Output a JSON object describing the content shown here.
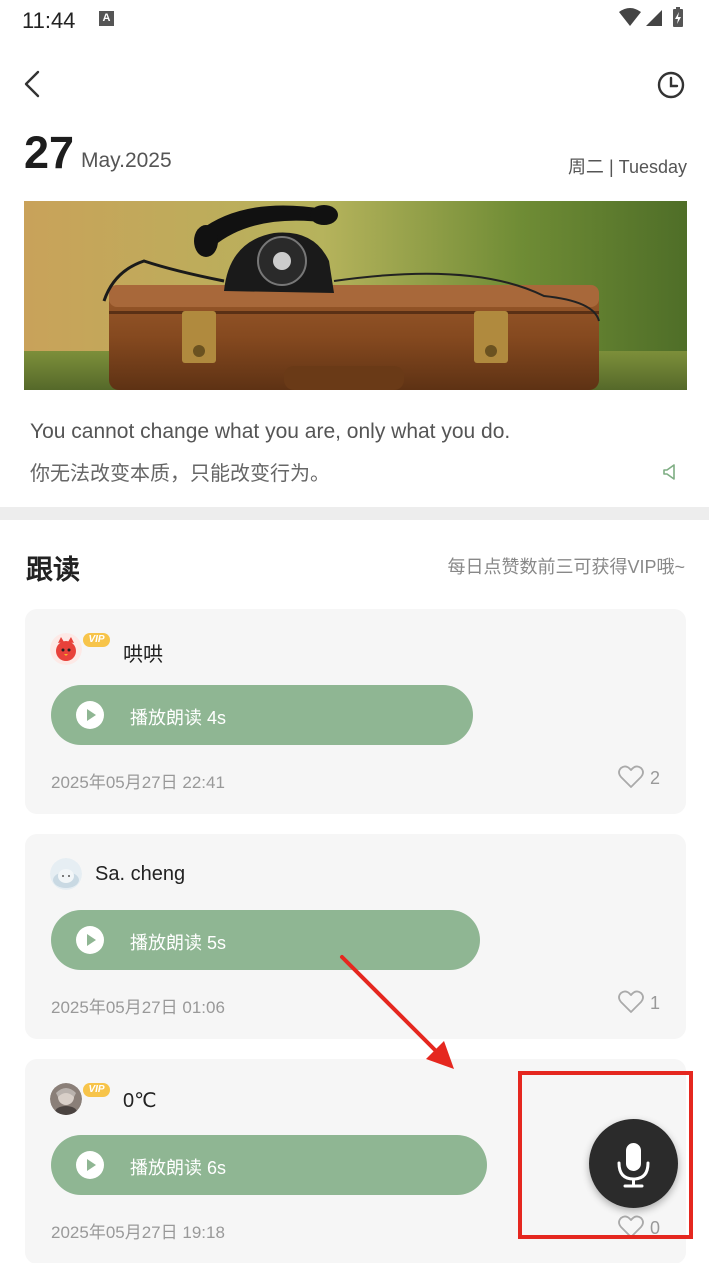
{
  "status_bar": {
    "time": "11:44",
    "notification_letter": "A"
  },
  "header": {
    "back_icon": "chevron-left-icon",
    "history_icon": "clock-icon"
  },
  "date": {
    "day": "27",
    "month_year": "May.2025",
    "weekday": "周二 | Tuesday"
  },
  "quote": {
    "en": "You cannot change what you are, only what you do.",
    "zh": "你无法改变本质，只能改变行为。"
  },
  "section": {
    "title": "跟读",
    "tip": "每日点赞数前三可获得VIP哦~"
  },
  "entries": [
    {
      "username": "哄哄",
      "vip_label": "VIP",
      "play_label": "播放朗读  4s",
      "timestamp": "2025年05月27日 22:41",
      "likes": "2"
    },
    {
      "username": "Sa. cheng",
      "play_label": "播放朗读  5s",
      "timestamp": "2025年05月27日 01:06",
      "likes": "1"
    },
    {
      "username": "0℃",
      "vip_label": "VIP",
      "play_label": "播放朗读  6s",
      "timestamp": "2025年05月27日 19:18",
      "likes": "0"
    }
  ],
  "colors": {
    "accent_green": "#8fb693",
    "vip_gold": "#f7c44a",
    "annotation_red": "#e5271f",
    "fab_dark": "#2b2b2b"
  },
  "fab": {
    "icon": "microphone-icon"
  }
}
